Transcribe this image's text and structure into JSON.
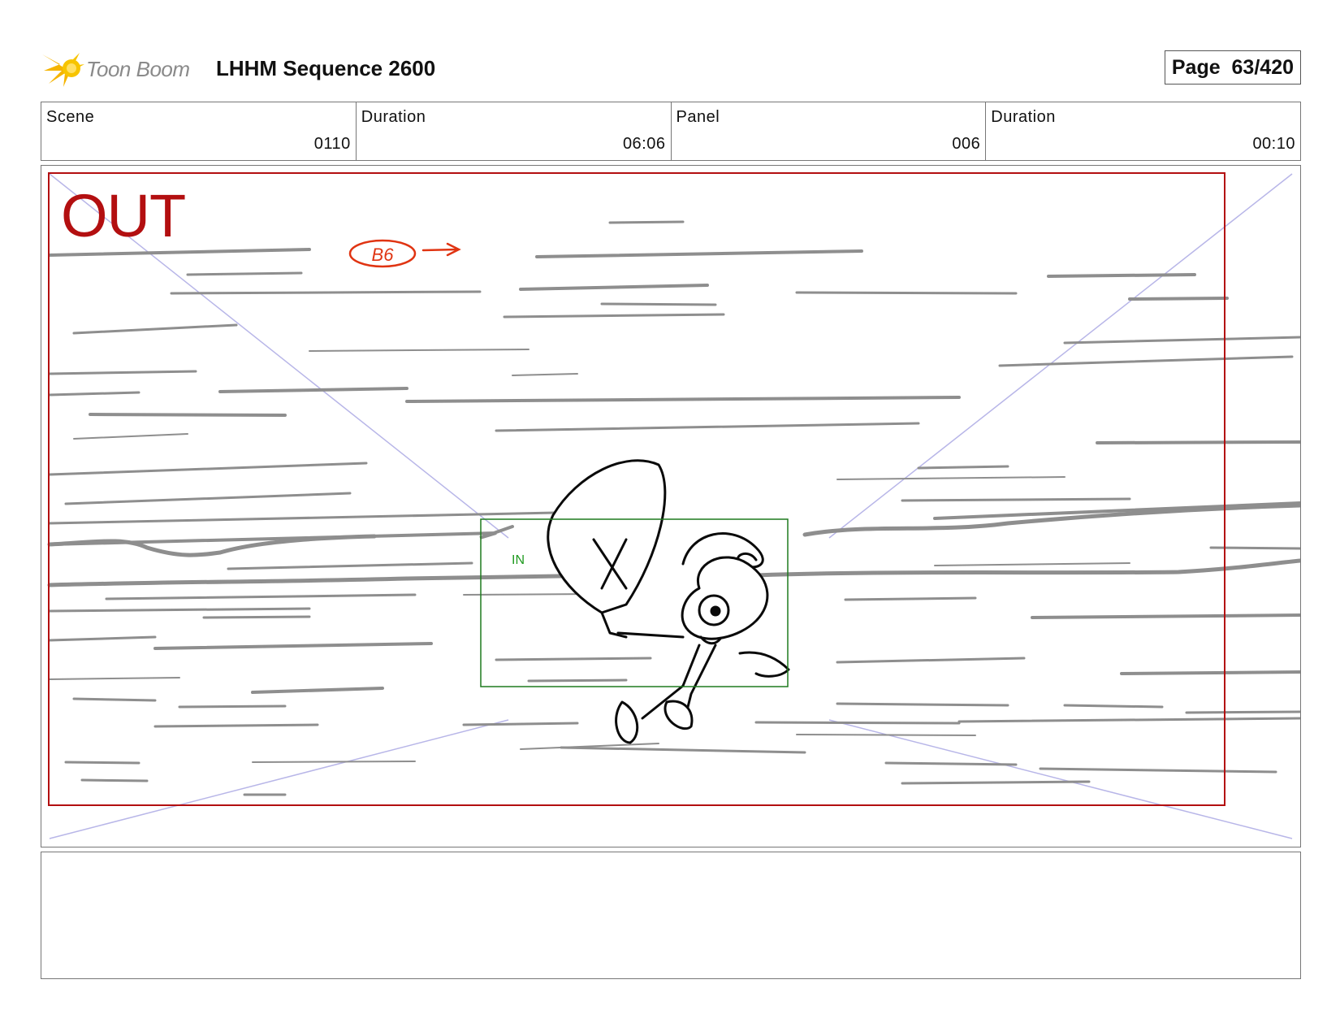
{
  "header": {
    "logo_text": "Toon Boom",
    "sequence_title": "LHHM Sequence 2600",
    "page_label": "Page",
    "page_number": "63/420"
  },
  "info": {
    "scene_label": "Scene",
    "scene_value": "0110",
    "scene_duration_label": "Duration",
    "scene_duration_value": "06:06",
    "panel_label": "Panel",
    "panel_value": "006",
    "panel_duration_label": "Duration",
    "panel_duration_value": "00:10"
  },
  "panel": {
    "out_label": "OUT",
    "in_label": "IN",
    "annotation": "B6"
  },
  "notes": {
    "text": ""
  },
  "colors": {
    "out_frame": "#b30f10",
    "in_frame": "#1f7a1f",
    "guide_lines": "#b8b6e8",
    "annotation": "#e03412"
  },
  "icons": [
    "toon-boom-logo-icon",
    "arrow-right-icon"
  ]
}
